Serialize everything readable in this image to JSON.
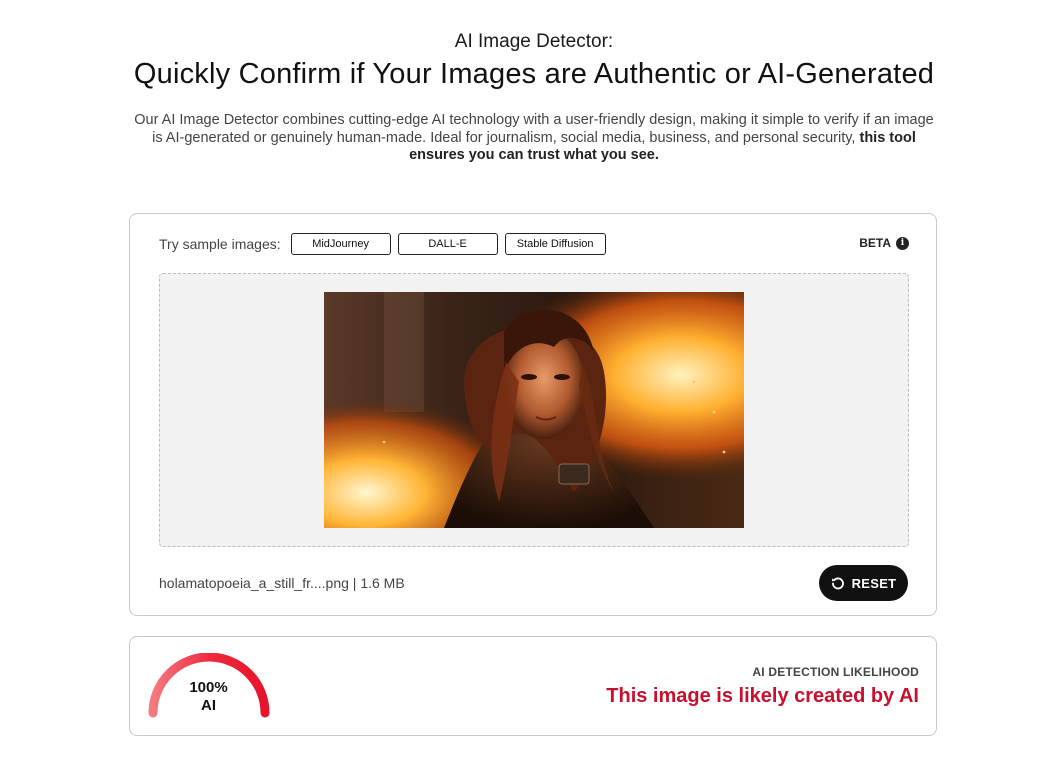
{
  "header": {
    "subtitle": "AI Image Detector:",
    "title": "Quickly Confirm if Your Images are Authentic or AI-Generated",
    "intro": "Our AI Image Detector combines cutting-edge AI technology with a user-friendly design, making it simple to verify if an image is AI-generated or genuinely human-made. Ideal for journalism, social media, business, and personal security,",
    "intro_bold": "this tool ensures you can trust what you see."
  },
  "upload": {
    "sample_label": "Try sample images:",
    "samples": [
      "MidJourney",
      "DALL-E",
      "Stable Diffusion"
    ],
    "beta_label": "BETA",
    "info_icon": "info-icon",
    "file_info": "holamatopoeia_a_still_fr....png | 1.6 MB",
    "reset_label": "RESET",
    "reset_icon": "reset-icon"
  },
  "result": {
    "gauge_value": "100%",
    "gauge_unit": "AI",
    "likelihood_fraction": 1.0,
    "label": "AI DETECTION LIKELIHOOD",
    "verdict": "This image is likely created by AI"
  },
  "colors": {
    "verdict": "#c8102e",
    "gauge": "#ef2a3f",
    "button_bg": "#111111"
  }
}
